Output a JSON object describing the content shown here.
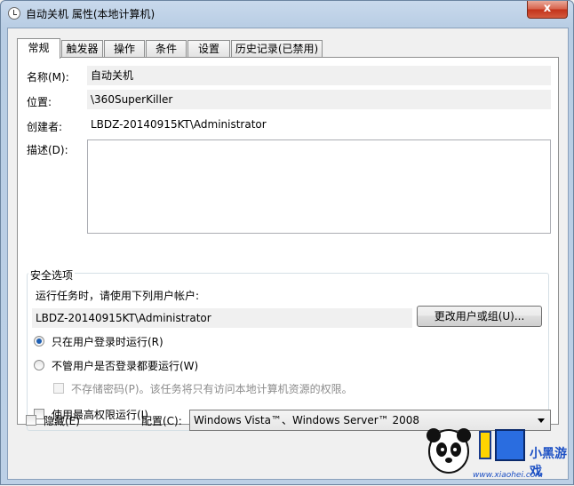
{
  "window": {
    "title": "自动关机 属性(本地计算机)",
    "close_glyph": "x"
  },
  "tabs": [
    "常规",
    "触发器",
    "操作",
    "条件",
    "设置",
    "历史记录(已禁用)"
  ],
  "general": {
    "name_label": "名称(M):",
    "name_value": "自动关机",
    "location_label": "位置:",
    "location_value": "\\360SuperKiller",
    "author_label": "创建者:",
    "author_value": "LBDZ-20140915KT\\Administrator",
    "description_label": "描述(D):",
    "description_value": ""
  },
  "security": {
    "group_title": "安全选项",
    "run_as_label": "运行任务时，请使用下列用户帐户:",
    "user_account": "LBDZ-20140915KT\\Administrator",
    "change_user_button": "更改用户或组(U)...",
    "radio_logged_on": "只在用户登录时运行(R)",
    "radio_logged_on_checked": true,
    "radio_whether_logged": "不管用户是否登录都要运行(W)",
    "radio_whether_logged_checked": false,
    "no_store_password": "不存储密码(P)。该任务将只有访问本地计算机资源的权限。",
    "highest_privileges": "使用最高权限运行(I)"
  },
  "footer": {
    "hidden_label": "隐藏(E)",
    "configure_label": "配置(C):",
    "configure_value": "Windows Vista™、Windows Server™ 2008"
  },
  "watermark": {
    "brand": "小黑游戏",
    "url": "www.xiaohei.com"
  },
  "colors": {
    "accent_radio": "#1e5fb3",
    "close_button": "#c2321a",
    "frame": "#bcd0e6"
  }
}
